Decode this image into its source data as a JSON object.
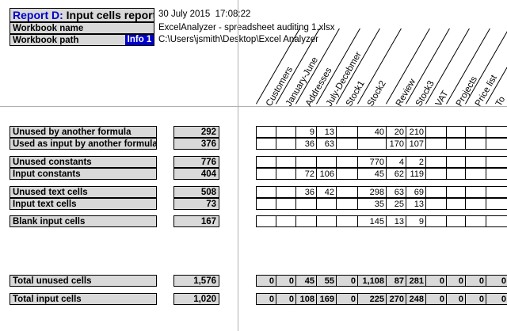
{
  "report": {
    "label": "Report D:",
    "title": "Input cells report",
    "date": "30 July 2015",
    "time": "17:08:22"
  },
  "workbook": {
    "name_label": "Workbook name",
    "name_value": "ExcelAnalyzer - spreadsheet auditing 1.xlsx",
    "path_label": "Workbook path",
    "path_value": "C:\\Users\\jsmith\\Desktop\\Excel Analyzer",
    "info_badge": "Info 1"
  },
  "columns": [
    "Customers",
    "January-June",
    "Addresses",
    "July-Decebmer",
    "Stock1",
    "Stock2",
    "Review",
    "Stock3",
    "VAT",
    "Projects",
    "Price list",
    "To"
  ],
  "rows": [
    {
      "label": "Unused by another formula",
      "total": "292",
      "cells": [
        "",
        "",
        "9",
        "13",
        "",
        "40",
        "20",
        "210",
        "",
        "",
        "",
        ""
      ]
    },
    {
      "label": "Used as input by another formula",
      "total": "376",
      "cells": [
        "",
        "",
        "36",
        "63",
        "",
        "",
        "170",
        "107",
        "",
        "",
        "",
        ""
      ]
    },
    {
      "label": "Unused constants",
      "total": "776",
      "cells": [
        "",
        "",
        "",
        "",
        "",
        "770",
        "4",
        "2",
        "",
        "",
        "",
        ""
      ]
    },
    {
      "label": "Input constants",
      "total": "404",
      "cells": [
        "",
        "",
        "72",
        "106",
        "",
        "45",
        "62",
        "119",
        "",
        "",
        "",
        ""
      ]
    },
    {
      "label": "Unused text cells",
      "total": "508",
      "cells": [
        "",
        "",
        "36",
        "42",
        "",
        "298",
        "63",
        "69",
        "",
        "",
        "",
        ""
      ]
    },
    {
      "label": "Input text cells",
      "total": "73",
      "cells": [
        "",
        "",
        "",
        "",
        "",
        "35",
        "25",
        "13",
        "",
        "",
        "",
        ""
      ]
    },
    {
      "label": "Blank input cells",
      "total": "167",
      "cells": [
        "",
        "",
        "",
        "",
        "",
        "145",
        "13",
        "9",
        "",
        "",
        "",
        ""
      ]
    },
    {
      "label": "Total unused cells",
      "total": "1,576",
      "cells": [
        "0",
        "0",
        "45",
        "55",
        "0",
        "1,108",
        "87",
        "281",
        "0",
        "0",
        "0",
        "0"
      ]
    },
    {
      "label": "Total input cells",
      "total": "1,020",
      "cells": [
        "0",
        "0",
        "108",
        "169",
        "0",
        "225",
        "270",
        "248",
        "0",
        "0",
        "0",
        "0"
      ]
    }
  ]
}
